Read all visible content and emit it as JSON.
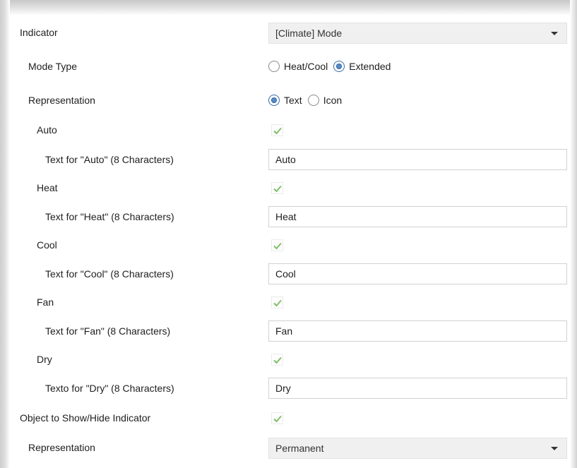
{
  "indicator": {
    "label": "Indicator",
    "value": "[Climate] Mode"
  },
  "mode_type": {
    "label": "Mode Type",
    "options": [
      {
        "label": "Heat/Cool",
        "selected": false
      },
      {
        "label": "Extended",
        "selected": true
      }
    ]
  },
  "representation": {
    "label": "Representation",
    "options": [
      {
        "label": "Text",
        "selected": true
      },
      {
        "label": "Icon",
        "selected": false
      }
    ]
  },
  "modes": [
    {
      "label": "Auto",
      "checked": true,
      "text_label": "Text for \"Auto\" (8 Characters)",
      "text_value": "Auto"
    },
    {
      "label": "Heat",
      "checked": true,
      "text_label": "Text for \"Heat\" (8 Characters)",
      "text_value": "Heat"
    },
    {
      "label": "Cool",
      "checked": true,
      "text_label": "Text for \"Cool\" (8 Characters)",
      "text_value": "Cool"
    },
    {
      "label": "Fan",
      "checked": true,
      "text_label": "Text for \"Fan\" (8 Characters)",
      "text_value": "Fan"
    },
    {
      "label": "Dry",
      "checked": true,
      "text_label": "Texto for \"Dry\" (8 Characters)",
      "text_value": "Dry"
    }
  ],
  "object_show_hide": {
    "label": "Object to Show/Hide Indicator",
    "checked": true
  },
  "representation_permanent": {
    "label": "Representation",
    "value": "Permanent"
  },
  "colors": {
    "check_mark": "#7fbf6a",
    "radio_selected": "#5a8ac6",
    "dropdown_bg": "#f0f0f0"
  }
}
